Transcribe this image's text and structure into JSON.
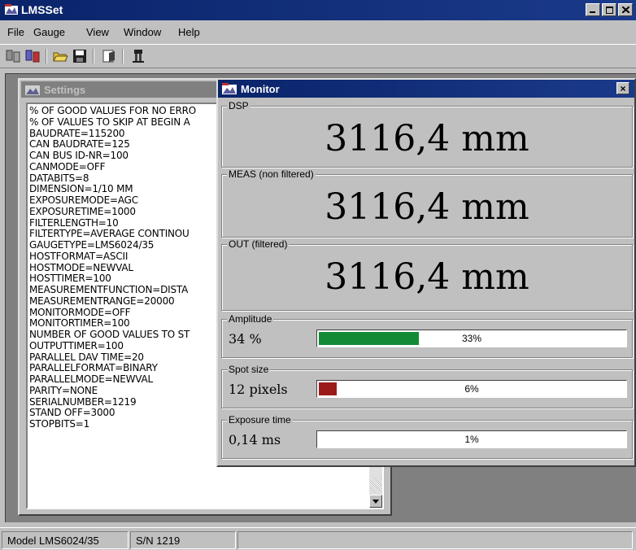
{
  "app": {
    "title": "LMSSet"
  },
  "menu": [
    {
      "label": "File",
      "u": "F"
    },
    {
      "label": "Gauge",
      "u": "G"
    },
    {
      "label": "View",
      "u": "V"
    },
    {
      "label": "Window",
      "u": "W"
    },
    {
      "label": "Help",
      "u": "H"
    }
  ],
  "settings": {
    "title": "Settings",
    "lines": [
      "% OF GOOD VALUES FOR NO ERRO",
      "% OF VALUES TO SKIP AT BEGIN A",
      "BAUDRATE=115200",
      "CAN BAUDRATE=125",
      "CAN BUS ID-NR=100",
      "CANMODE=OFF",
      "DATABITS=8",
      "DIMENSION=1/10 MM",
      "EXPOSUREMODE=AGC",
      "EXPOSURETIME=1000",
      "FILTERLENGTH=10",
      "FILTERTYPE=AVERAGE CONTINOU",
      "GAUGETYPE=LMS6024/35",
      "HOSTFORMAT=ASCII",
      "HOSTMODE=NEWVAL",
      "HOSTTIMER=100",
      "MEASUREMENTFUNCTION=DISTA",
      "MEASUREMENTRANGE=20000",
      "MONITORMODE=OFF",
      "MONITORTIMER=100",
      "NUMBER OF GOOD VALUES TO ST",
      "OUTPUTTIMER=100",
      "PARALLEL DAV TIME=20",
      "PARALLELFORMAT=BINARY",
      "PARALLELMODE=NEWVAL",
      "PARITY=NONE",
      "SERIALNUMBER=1219",
      "STAND OFF=3000",
      "STOPBITS=1"
    ]
  },
  "monitor": {
    "title": "Monitor",
    "close": "×",
    "dsp": {
      "label": "DSP",
      "value": "3116,4 mm"
    },
    "meas": {
      "label": "MEAS (non filtered)",
      "value": "3116,4 mm"
    },
    "out": {
      "label": "OUT (filtered)",
      "value": "3116,4 mm"
    },
    "amplitude": {
      "label": "Amplitude",
      "value": "34 %",
      "pct": "33%",
      "fill": 0.33,
      "color": "#138a36"
    },
    "spot": {
      "label": "Spot size",
      "value": "12 pixels",
      "pct": "6%",
      "fill": 0.06,
      "color": "#9b1b1b"
    },
    "exposure": {
      "label": "Exposure time",
      "value": "0,14 ms",
      "pct": "1%",
      "fill": 0.0,
      "color": "#000080"
    }
  },
  "status": {
    "model": "Model LMS6024/35",
    "sn": "S/N 1219"
  },
  "icons": [
    "app-icon",
    "connect-icon",
    "disconnect-icon",
    "open-folder-icon",
    "save-icon",
    "properties-icon",
    "gauge-icon"
  ]
}
